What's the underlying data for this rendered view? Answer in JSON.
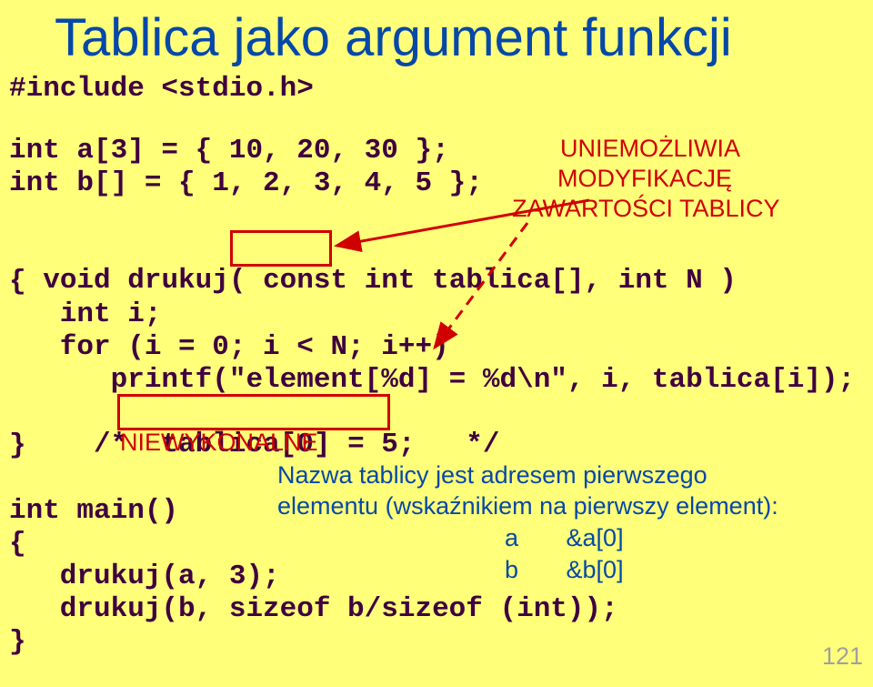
{
  "title": "Tablica jako argument funkcji",
  "code": {
    "l1": "#include <stdio.h>",
    "l2": "int a[3] = { 10, 20, 30 };",
    "l3": "int b[] = { 1, 2, 3, 4, 5 };",
    "l4a": "void drukuj( ",
    "l4b": "const",
    "l4c": " int tablica[], int N )",
    "l5": "{",
    "l6": "   int i;",
    "l7": "   for (i = 0; i < N; i++)",
    "l8": "      printf(\"element[%d] = %d\\n\", i, tablica[i]);",
    "l9a": "   /*  ",
    "l9b": "tablica[0] = 5;",
    "l9c": "   */",
    "l10": "}",
    "l11": "int main()",
    "l12": "{",
    "l13": "   drukuj(a, 3);",
    "l14": "   drukuj(b, sizeof b/sizeof (int));",
    "l15": "}"
  },
  "annotations": {
    "uniemozliwia_l1": "UNIEMOŻLIWIA",
    "uniemozliwia_l2": "MODYFIKACJĘ",
    "uniemozliwia_l3": "ZAWARTOŚCI TABLICY",
    "niewykonalne": "NIEWYKONALNE"
  },
  "blue_notes": {
    "l1": "Nazwa tablicy jest adresem pierwszego",
    "l2": "elementu (wskaźnikiem na pierwszy element):",
    "l3": "a       &a[0]",
    "l4": "b       &b[0]"
  },
  "page_number": "121"
}
